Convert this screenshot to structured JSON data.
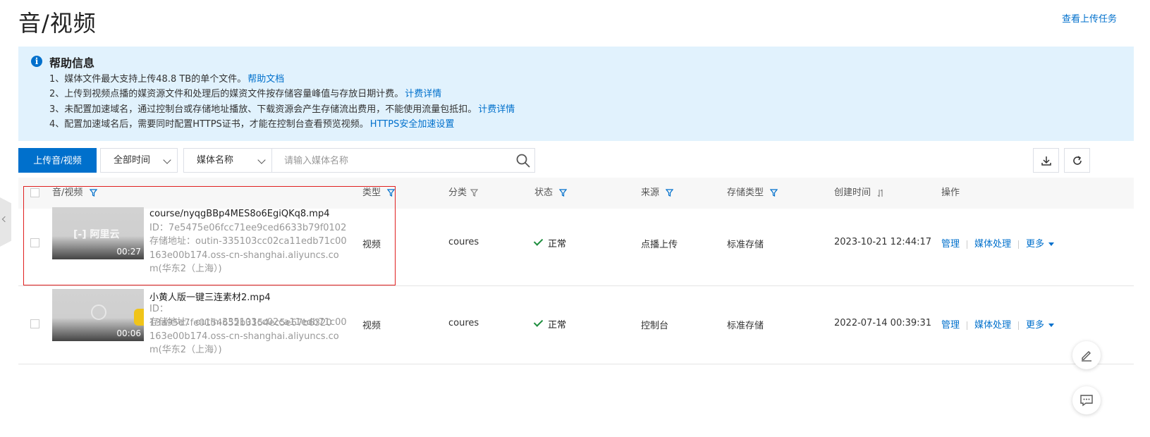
{
  "header": {
    "title": "音/视频",
    "upload_tasks_link": "查看上传任务"
  },
  "help": {
    "title": "帮助信息",
    "lines": [
      {
        "text": "1、媒体文件最大支持上传48.8 TB的单个文件。",
        "link": "帮助文档"
      },
      {
        "text": "2、上传到视频点播的媒资源文件和处理后的媒资文件按存储容量峰值与存放日期计费。",
        "link": "计费详情"
      },
      {
        "text": "3、未配置加速域名，通过控制台或存储地址播放、下载资源会产生存储流出费用，不能使用流量包抵扣。",
        "link": "计费详情"
      },
      {
        "text": "4、配置加速域名后，需要同时配置HTTPS证书，才能在控制台查看预览视频。",
        "link": "HTTPS安全加速设置"
      }
    ]
  },
  "toolbar": {
    "upload_button": "上传音/视频",
    "time_filter": "全部时间",
    "search_field_type": "媒体名称",
    "search_placeholder": "请输入媒体名称"
  },
  "table": {
    "columns": {
      "media": "音/视频",
      "type": "类型",
      "category": "分类",
      "status": "状态",
      "source": "来源",
      "storage_type": "存储类型",
      "created": "创建时间",
      "actions": "操作"
    },
    "rows": [
      {
        "name": "course/nyqgBBp4MES8o6EgiQKq8.mp4",
        "duration": "00:27",
        "thumb_logo": "[-] 阿里云",
        "id_line": "ID：7e5475e06fcc71ee9ced6633b79f0102",
        "storage_line": "存储地址：outin-335103cc02ca11edb71c00163e00b174.oss-cn-shanghai.aliyuncs.com(华东2（上海）)",
        "type": "视频",
        "category": "coures",
        "status": "正常",
        "source": "点播上传",
        "storage_type": "标准存储",
        "created": "2023-10-21 12:44:17",
        "op_manage": "管理",
        "op_process": "媒体处理",
        "op_more": "更多"
      },
      {
        "name": "小黄人版一键三连素材2.mp4",
        "duration": "00:06",
        "id_line": "ID：13a95d7fe0154652b3154ec5e67b6320",
        "storage_line": "存储地址：outin-335103cc02ca11edb71c00163e00b174.oss-cn-shanghai.aliyuncs.com(华东2（上海）)",
        "type": "视频",
        "category": "coures",
        "status": "正常",
        "source": "控制台",
        "storage_type": "标准存储",
        "created": "2022-07-14 00:39:31",
        "op_manage": "管理",
        "op_process": "媒体处理",
        "op_more": "更多"
      }
    ]
  },
  "colors": {
    "accent": "#0070cc",
    "help_bg": "#e1f2fd",
    "status_ok": "#1e8e3e",
    "highlight": "#e02020"
  }
}
